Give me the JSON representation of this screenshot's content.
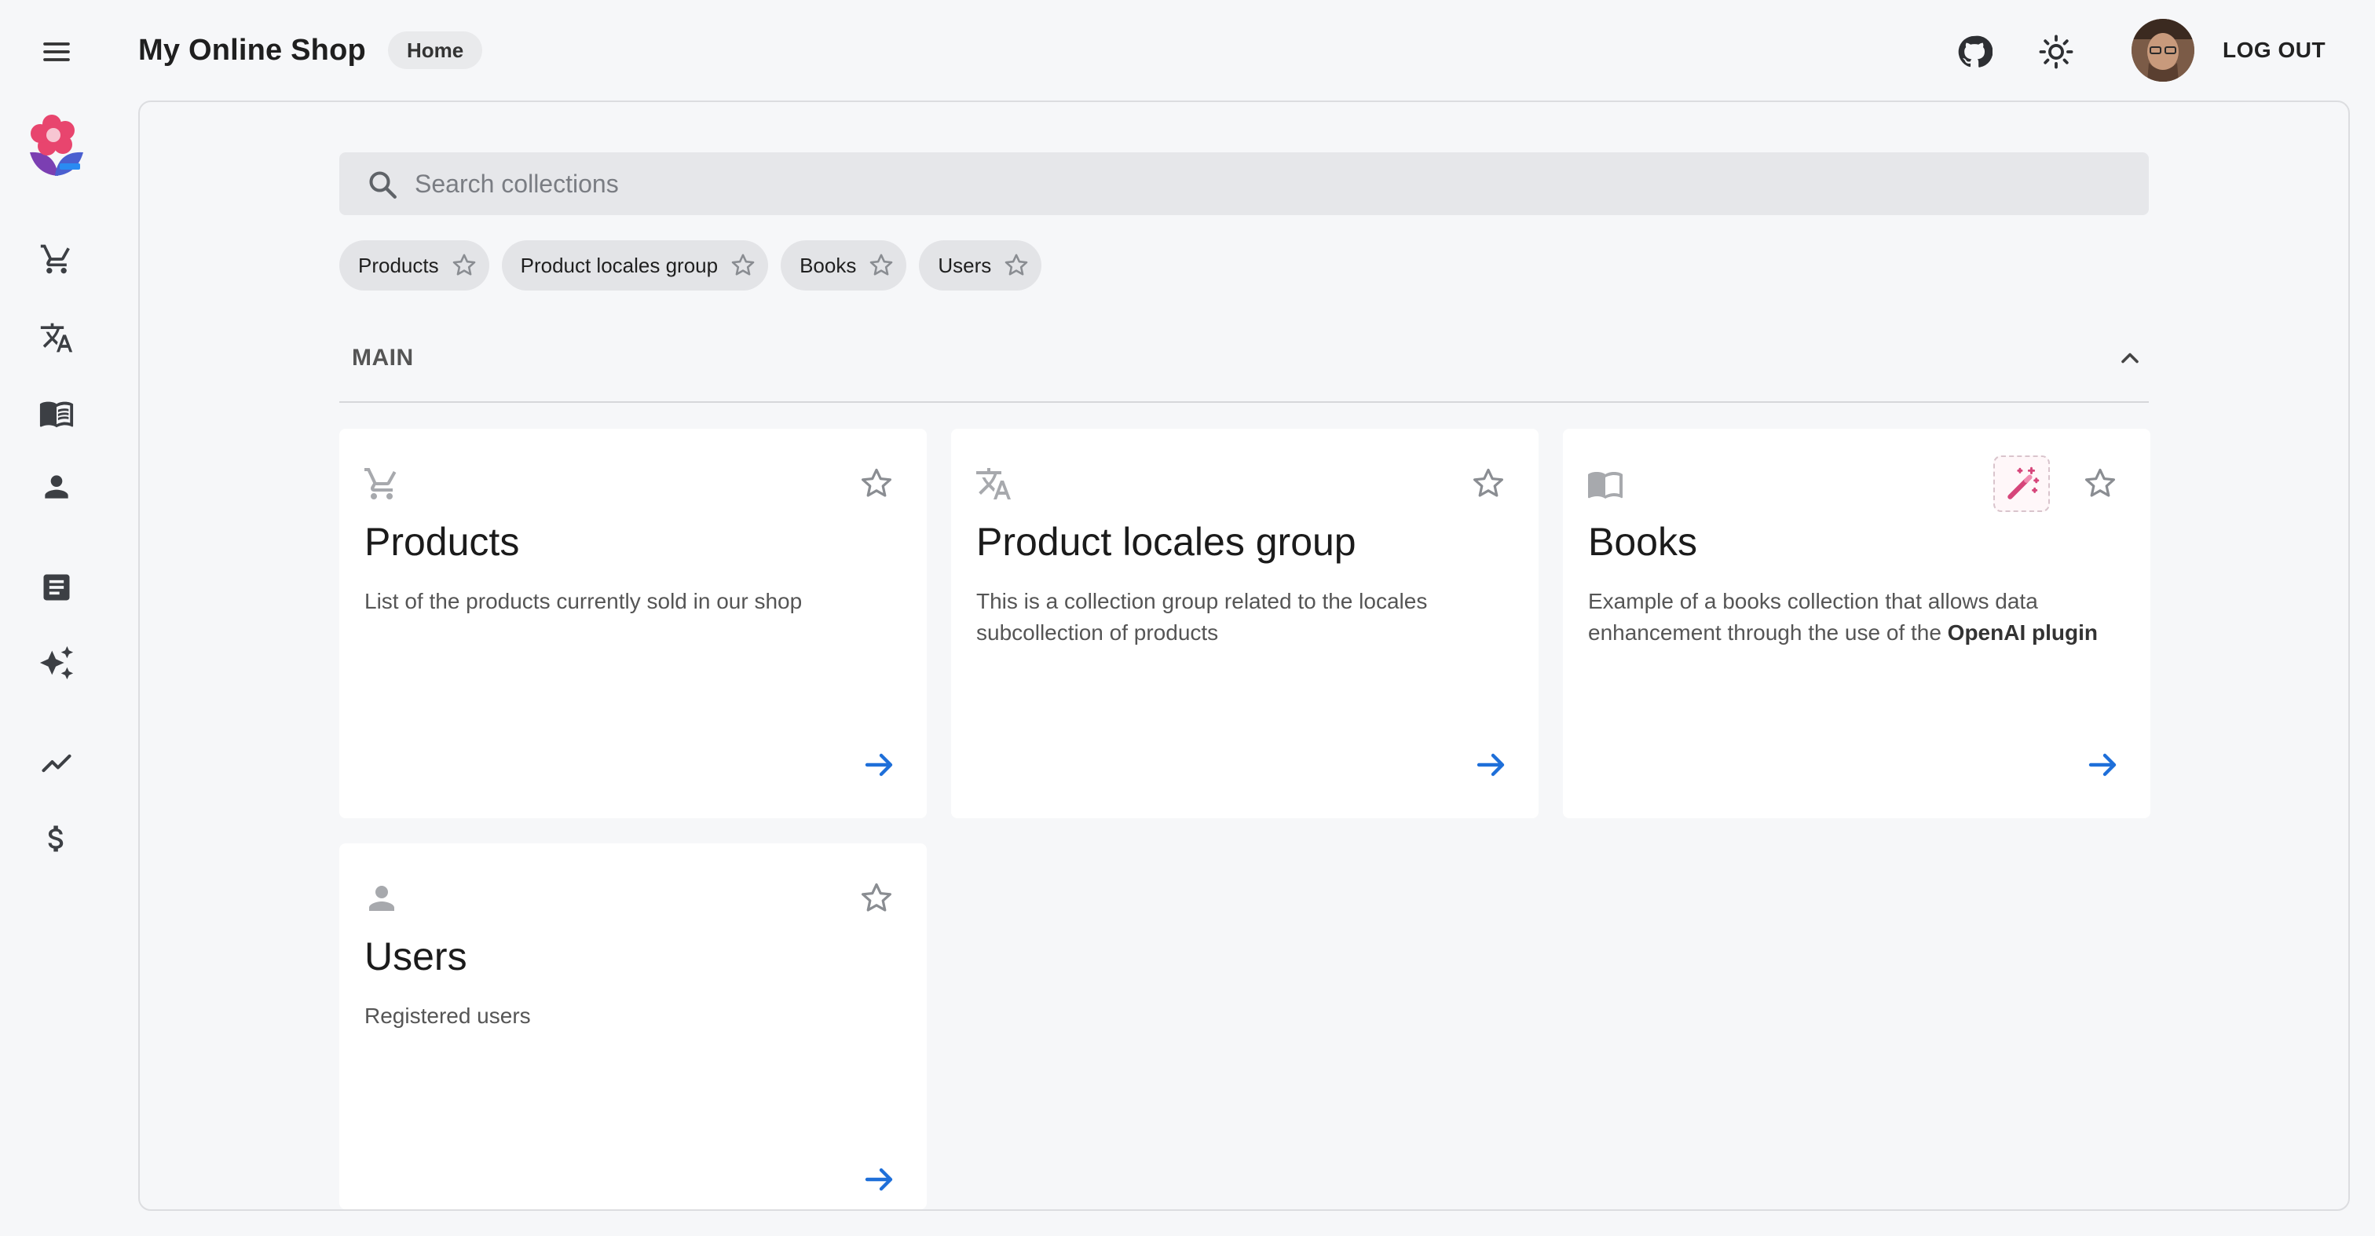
{
  "app": {
    "title": "My Online Shop",
    "breadcrumb": "Home",
    "logout_label": "LOG OUT"
  },
  "nav_icons": [
    "menu-icon",
    "github-icon",
    "light-mode-icon",
    "avatar"
  ],
  "rail": {
    "items": [
      {
        "icon": "shopping-cart-icon"
      },
      {
        "icon": "translate-icon"
      },
      {
        "icon": "book-icon"
      },
      {
        "icon": "person-icon"
      },
      {
        "icon": "article-icon"
      },
      {
        "icon": "sparkle-icon"
      },
      {
        "icon": "trending-up-icon"
      },
      {
        "icon": "dollar-icon"
      }
    ]
  },
  "search": {
    "placeholder": "Search collections"
  },
  "chips": [
    {
      "label": "Products"
    },
    {
      "label": "Product locales group"
    },
    {
      "label": "Books"
    },
    {
      "label": "Users"
    }
  ],
  "section": {
    "title": "MAIN"
  },
  "cards": [
    {
      "title": "Products",
      "description": "List of the products currently sold in our shop",
      "icon": "shopping-cart-icon"
    },
    {
      "title": "Product locales group",
      "description": "This is a collection group related to the locales subcollection of products",
      "icon": "translate-icon"
    },
    {
      "title": "Books",
      "description_prefix": "Example of a books collection that allows data enhancement through the use of the ",
      "description_bold": "OpenAI plugin",
      "icon": "book-icon",
      "badge_icon": "magic-wand-icon"
    },
    {
      "title": "Users",
      "description": "Registered users",
      "icon": "person-icon"
    }
  ],
  "colors": {
    "background": "#f6f7f9",
    "accent": "#1e6fd9",
    "plugin": "#d6457a",
    "icon_muted": "#a7a9ad"
  }
}
